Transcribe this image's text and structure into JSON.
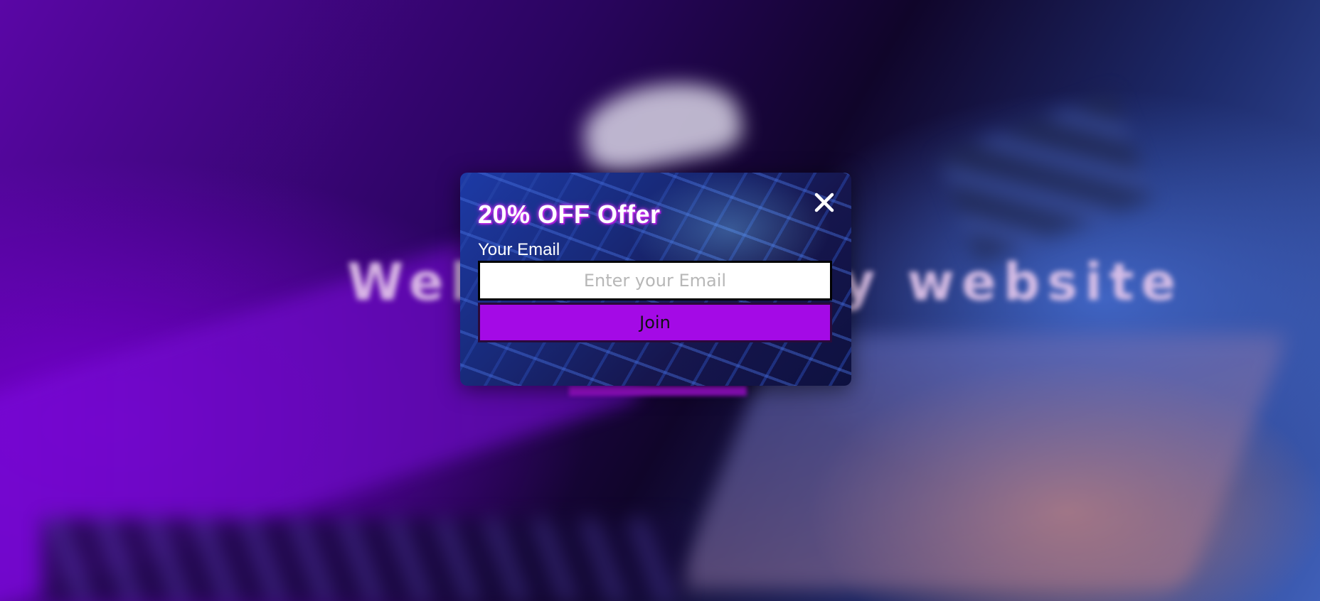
{
  "background": {
    "heading": "Welcome to my website",
    "accent_color": "#a310d9"
  },
  "popup": {
    "title": "20% OFF Offer",
    "close_icon": "close-icon",
    "email": {
      "label": "Your Email",
      "value": "",
      "placeholder": "Enter your Email"
    },
    "join_button_label": "Join",
    "colors": {
      "button": "#a40ae6",
      "title_glow": "#d84cff",
      "input_background": "#ffffff"
    }
  }
}
